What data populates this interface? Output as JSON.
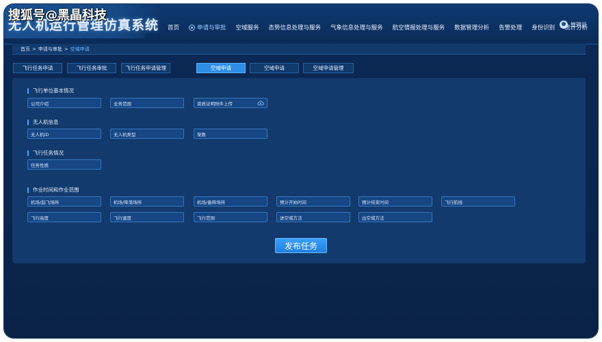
{
  "app": {
    "title": "无人机运行管理仿真系统",
    "watermark": "搜狐号@黑晶科技",
    "user": "管理员"
  },
  "nav": [
    {
      "label": "首页"
    },
    {
      "label": "申请与审批"
    },
    {
      "label": "空域服务"
    },
    {
      "label": "态势信息处理与服务"
    },
    {
      "label": "气象信息处理与服务"
    },
    {
      "label": "航空情报处理与服务"
    },
    {
      "label": "数据管理分析"
    },
    {
      "label": "告警处理"
    },
    {
      "label": "身份识别"
    },
    {
      "label": "统计分析"
    }
  ],
  "breadcrumb": {
    "home": "首页",
    "level1": "申请与审批",
    "current": "空域申请",
    "sep": ">"
  },
  "tabs": [
    {
      "label": "飞行任务申请"
    },
    {
      "label": "飞行任务审批"
    },
    {
      "label": "飞行任务申请管理"
    },
    {
      "label": "空域申请"
    },
    {
      "label": "空域申请"
    },
    {
      "label": "空域申请管理"
    }
  ],
  "sections": {
    "unit": {
      "title": "飞行单位基本情况",
      "fields": [
        "公司介绍",
        "业务范围",
        "资质证明附件上传"
      ]
    },
    "uav": {
      "title": "无人机信息",
      "fields": [
        "无人机ID",
        "无人机类型",
        "架数"
      ]
    },
    "task": {
      "title": "飞行任务情况",
      "fields": [
        "任务性质"
      ]
    },
    "operation": {
      "title": "作业时间和作业范围",
      "fields": [
        "机场/起飞场所",
        "机场/降落场所",
        "机场/备降场所",
        "预计开始时间",
        "预计结束时间",
        "飞行航线",
        "飞行高度",
        "飞行速度",
        "飞行范围",
        "进空域方法",
        "出空域方法"
      ]
    }
  },
  "submit_label": "发布任务"
}
